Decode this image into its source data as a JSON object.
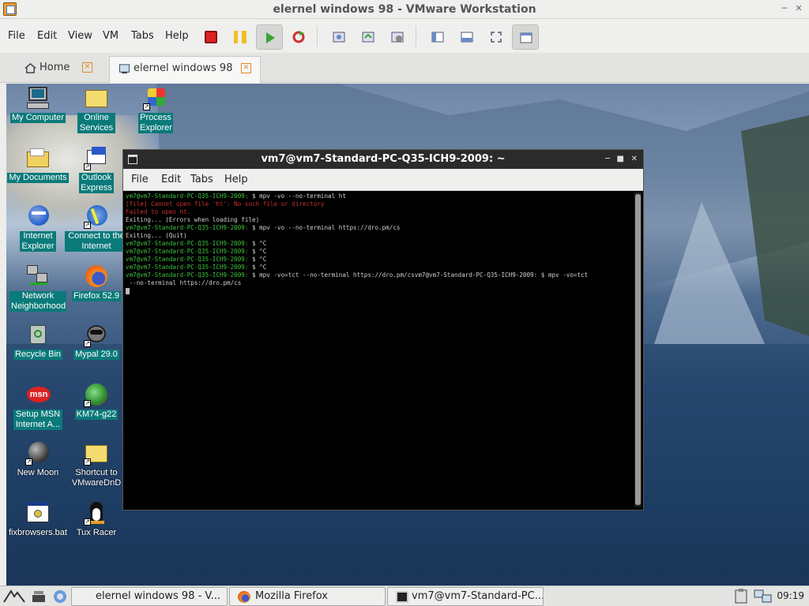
{
  "window": {
    "title": "elernel windows 98 - VMware Workstation"
  },
  "menu": [
    "File",
    "Edit",
    "View",
    "VM",
    "Tabs",
    "Help"
  ],
  "toolbar": {
    "buttons": [
      "power-off-icon",
      "suspend-icon",
      "play-icon",
      "reset-icon",
      "snapshot-icon",
      "revert-snapshot-icon",
      "snapshot-manager-icon",
      "view-sidebar-icon",
      "view-console-icon",
      "fullscreen-icon",
      "unity-icon"
    ]
  },
  "tabs": [
    {
      "label": "Home",
      "icon": "home-icon"
    },
    {
      "label": "elernel windows 98",
      "icon": "vm-icon",
      "active": true
    }
  ],
  "desktop": {
    "icons": [
      {
        "label": "My Computer"
      },
      {
        "label": "Online Services"
      },
      {
        "label": "Process Explorer"
      },
      {
        "label": "My Documents"
      },
      {
        "label": "Outlook Express"
      },
      {
        "label": "Internet Explorer"
      },
      {
        "label": "Connect to the Internet"
      },
      {
        "label": "Network Neighborhood"
      },
      {
        "label": "Firefox 52.9"
      },
      {
        "label": "Recycle Bin"
      },
      {
        "label": "Mypal 29.0"
      },
      {
        "label": "Setup MSN Internet A..."
      },
      {
        "label": "KM74-g22"
      },
      {
        "label": "New Moon"
      },
      {
        "label": "Shortcut to VMwareDnD"
      },
      {
        "label": "fixbrowsers.bat"
      },
      {
        "label": "Tux Racer"
      }
    ]
  },
  "terminal": {
    "title": "vm7@vm7-Standard-PC-Q35-ICH9-2009: ~",
    "menu": [
      "File",
      "Edit",
      "Tabs",
      "Help"
    ],
    "prompt": "vm7@vm7-Standard-PC-Q35-ICH9-2009:",
    "lines": [
      {
        "prompt": true,
        "text": " $ mpv -vo --no-terminal ht"
      },
      {
        "error": true,
        "text": "[file] Cannot open file 'ht': No such file or directory"
      },
      {
        "error": true,
        "text": "Failed to open ht."
      },
      {
        "text": "Exiting... (Errors when loading file)"
      },
      {
        "prompt": true,
        "text": " $ mpv -vo --no-terminal https://dro.pm/cs"
      },
      {
        "text": "Exiting... (Quit)"
      },
      {
        "prompt": true,
        "text": " $ ^C"
      },
      {
        "prompt": true,
        "text": " $ ^C"
      },
      {
        "prompt": true,
        "text": " $ ^C"
      },
      {
        "prompt": true,
        "text": " $ ^C"
      },
      {
        "prompt": true,
        "text": " $ mpv -vo=tct --no-terminal https://dro.pm/csvm7@vm7-Standard-PC-Q35-ICH9-2009: $ mpv -vo=tct"
      },
      {
        "text": " --no-terminal https://dro.pm/cs"
      }
    ]
  },
  "taskbar": {
    "tasks": [
      {
        "label": "elernel windows 98 - V...",
        "icon": "vmware-icon"
      },
      {
        "label": "Mozilla Firefox",
        "icon": "firefox-icon"
      },
      {
        "label": "vm7@vm7-Standard-PC...",
        "icon": "terminal-icon"
      }
    ],
    "clock": "09:19"
  }
}
